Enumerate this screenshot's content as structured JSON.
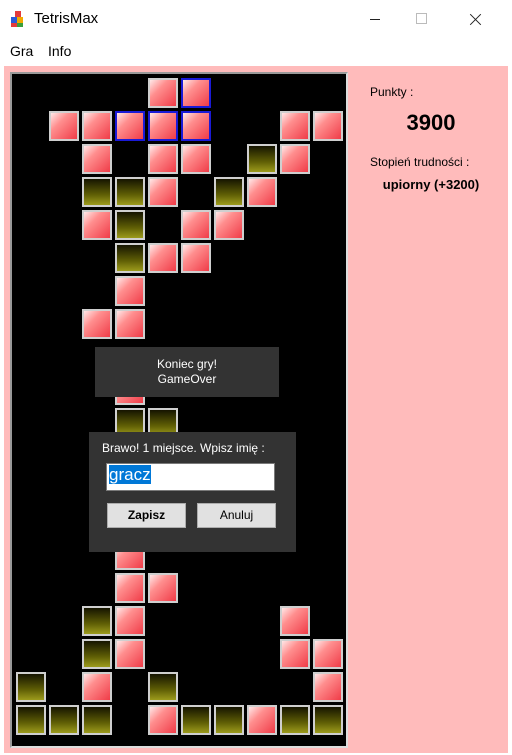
{
  "window": {
    "title": "TetrisMax",
    "app_icon": "tetris-blocks-icon"
  },
  "menu": [
    "Gra",
    "Info"
  ],
  "board": {
    "columns": 10,
    "rows": 20,
    "cells": [
      [
        4,
        0,
        "red"
      ],
      [
        5,
        0,
        "active"
      ],
      [
        1,
        1,
        "red"
      ],
      [
        2,
        1,
        "red"
      ],
      [
        3,
        1,
        "active"
      ],
      [
        4,
        1,
        "active"
      ],
      [
        5,
        1,
        "active"
      ],
      [
        8,
        1,
        "red"
      ],
      [
        9,
        1,
        "red"
      ],
      [
        2,
        2,
        "red"
      ],
      [
        4,
        2,
        "red"
      ],
      [
        5,
        2,
        "red"
      ],
      [
        7,
        2,
        "olive"
      ],
      [
        8,
        2,
        "red"
      ],
      [
        2,
        3,
        "olive"
      ],
      [
        3,
        3,
        "olive"
      ],
      [
        4,
        3,
        "red"
      ],
      [
        6,
        3,
        "olive"
      ],
      [
        7,
        3,
        "red"
      ],
      [
        2,
        4,
        "red"
      ],
      [
        3,
        4,
        "olive"
      ],
      [
        5,
        4,
        "red"
      ],
      [
        6,
        4,
        "red"
      ],
      [
        3,
        5,
        "olive"
      ],
      [
        4,
        5,
        "red"
      ],
      [
        5,
        5,
        "red"
      ],
      [
        3,
        6,
        "red"
      ],
      [
        2,
        7,
        "red"
      ],
      [
        3,
        7,
        "red"
      ],
      [
        3,
        9,
        "red"
      ],
      [
        3,
        10,
        "olive"
      ],
      [
        4,
        10,
        "olive"
      ],
      [
        3,
        14,
        "red"
      ],
      [
        3,
        15,
        "red"
      ],
      [
        4,
        15,
        "red"
      ],
      [
        2,
        16,
        "olive"
      ],
      [
        3,
        16,
        "red"
      ],
      [
        8,
        16,
        "red"
      ],
      [
        2,
        17,
        "olive"
      ],
      [
        3,
        17,
        "red"
      ],
      [
        8,
        17,
        "red"
      ],
      [
        9,
        17,
        "red"
      ],
      [
        0,
        18,
        "olive"
      ],
      [
        2,
        18,
        "red"
      ],
      [
        4,
        18,
        "olive"
      ],
      [
        9,
        18,
        "red"
      ],
      [
        0,
        19,
        "olive"
      ],
      [
        1,
        19,
        "olive"
      ],
      [
        2,
        19,
        "olive"
      ],
      [
        4,
        19,
        "red"
      ],
      [
        5,
        19,
        "olive"
      ],
      [
        6,
        19,
        "olive"
      ],
      [
        7,
        19,
        "red"
      ],
      [
        8,
        19,
        "olive"
      ],
      [
        9,
        19,
        "olive"
      ]
    ],
    "colors": {
      "red": "#f03c48",
      "olive": "#5f5e05",
      "active_border": "#1a1ad6",
      "background": "#000000"
    }
  },
  "game_over": {
    "line1": "Koniec gry!",
    "line2": "GameOver"
  },
  "dialog": {
    "prompt": "Brawo! 1 miejsce. Wpisz imię :",
    "name_value": "gracz",
    "save_label": "Zapisz",
    "cancel_label": "Anuluj"
  },
  "side": {
    "points_label": "Punkty :",
    "points_value": "3900",
    "difficulty_label": "Stopień trudności :",
    "difficulty_value": "upiorny (+3200)"
  },
  "colors": {
    "panel_bg": "#ffbbbb",
    "dialog_bg": "#333333",
    "selection": "#0078d7"
  }
}
